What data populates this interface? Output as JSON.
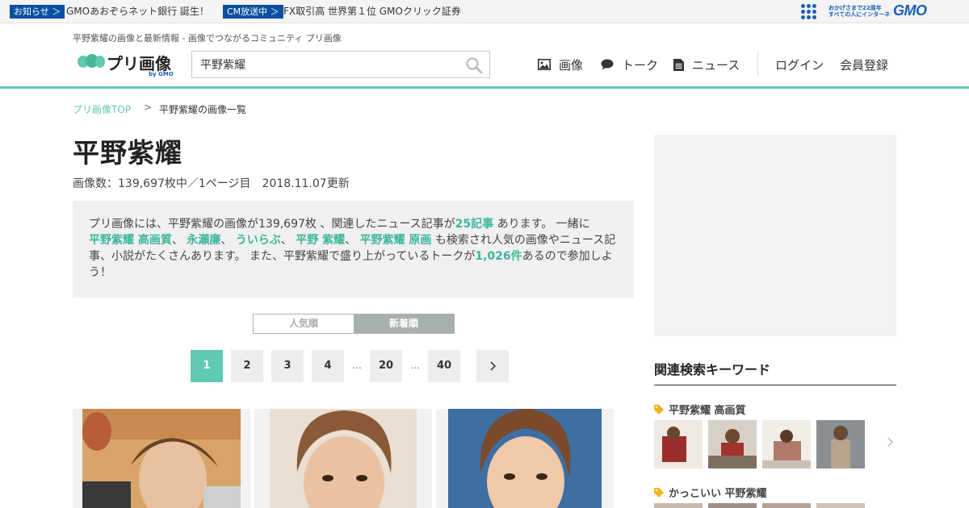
{
  "gmo_bar": {
    "badge1": "お知らせ ＞",
    "text1": "GMOあおぞらネット銀行 誕生！",
    "badge2": "CM放送中 ＞",
    "text2": "FX取引高 世界第１位 GMOクリック証券",
    "tag_line1": "おかげさまで22周年",
    "tag_line2": "すべての人にインターネット",
    "logo": "GMO"
  },
  "header": {
    "tagline": "平野紫耀の画像と最新情報 - 画像でつながるコミュニティ プリ画像",
    "logo_text": "プリ画像",
    "logo_by": "by GMO",
    "search_value": "平野紫耀",
    "nav": {
      "images": "画像",
      "talk": "トーク",
      "news": "ニュース",
      "login": "ログイン",
      "register": "会員登録"
    }
  },
  "breadcrumb": {
    "top": "プリ画像TOP",
    "sep": ">",
    "current": "平野紫耀の画像一覧"
  },
  "main": {
    "title": "平野紫耀",
    "meta_count": "画像数：139,697枚中／1ページ目",
    "meta_updated": "2018.11.07更新",
    "desc": {
      "t1": "プリ画像には、平野紫耀の画像が139,697枚 、関連したニュース記事が",
      "news_count": "25記事",
      "t2": "あります。 一緒に",
      "kw1": "平野紫耀 高画質",
      "sep": "、",
      "kw2": "永瀬廉",
      "kw3": "ういらぶ",
      "kw4": "平野 紫耀",
      "kw5": "平野紫耀 原画",
      "t3": "も検索され人気の画像やニュース記事、小説がたくさんあります。 また、平野紫耀で盛り上がっているトークが",
      "talk_count": "1,026件",
      "t4": "あるので参加しよう！"
    },
    "sort": {
      "popular": "人気順",
      "newest": "新着順"
    },
    "pagination": {
      "p1": "1",
      "p2": "2",
      "p3": "3",
      "p4": "4",
      "p20": "20",
      "p40": "40",
      "ellipsis": "…"
    }
  },
  "sidebar": {
    "title": "関連検索キーワード",
    "kw1": "平野紫耀 高画質",
    "kw2": "かっこいい 平野紫耀"
  },
  "colors": {
    "accent": "#5fc9b1",
    "link": "#3cb79a",
    "gmo_blue": "#0a4fa0"
  }
}
